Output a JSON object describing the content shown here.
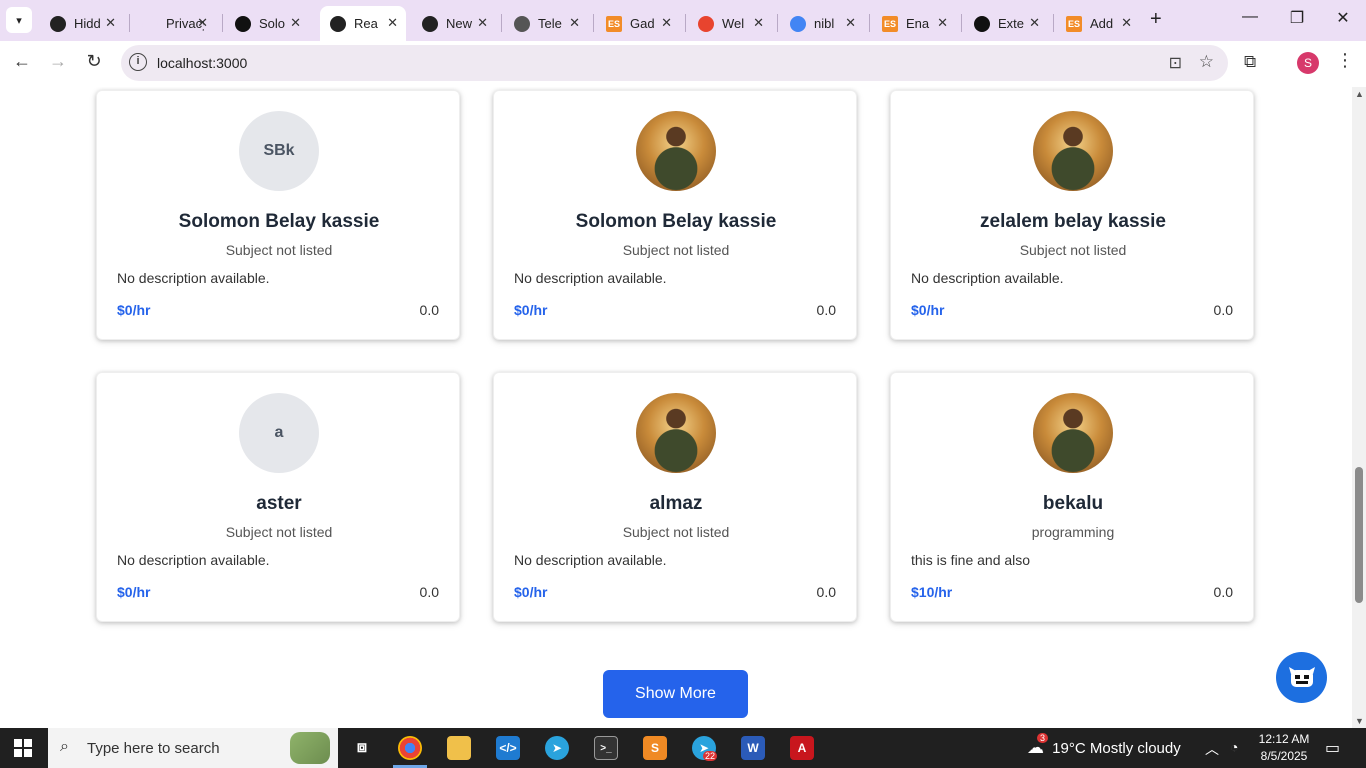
{
  "browser": {
    "tabs": [
      {
        "title": "Hidd",
        "icon": "openai-icon",
        "color": "#222222"
      },
      {
        "title": "Privacy e",
        "icon": "blank-icon",
        "color": "#ecdff5"
      },
      {
        "title": "Solo",
        "icon": "upwork-icon",
        "color": "#111111"
      },
      {
        "title": "Rea",
        "icon": "react-icon",
        "color": "#222222"
      },
      {
        "title": "New",
        "icon": "openai-icon",
        "color": "#222222"
      },
      {
        "title": "Tele",
        "icon": "globe-icon",
        "color": "#555555"
      },
      {
        "title": "Gad",
        "icon": "es-icon",
        "color": "#f28c28"
      },
      {
        "title": "Wel",
        "icon": "link-icon",
        "color": "#e8442e"
      },
      {
        "title": "nibl",
        "icon": "google-icon",
        "color": "#4285f4"
      },
      {
        "title": "Ena",
        "icon": "es-icon",
        "color": "#f28c28"
      },
      {
        "title": "Exte",
        "icon": "angular-icon",
        "color": "#111111"
      },
      {
        "title": "Add",
        "icon": "es-icon",
        "color": "#f28c28"
      }
    ],
    "active_tab": 3,
    "url": "localhost:3000",
    "profile_initial": "S"
  },
  "tutors": [
    {
      "avatar_type": "initials",
      "initials": "SBk",
      "name": "Solomon Belay kassie",
      "subject": "Subject not listed",
      "description": "No description available.",
      "rate": "$0/hr",
      "rating": "0.0"
    },
    {
      "avatar_type": "photo",
      "initials": "",
      "name": "Solomon Belay kassie",
      "subject": "Subject not listed",
      "description": "No description available.",
      "rate": "$0/hr",
      "rating": "0.0"
    },
    {
      "avatar_type": "photo",
      "initials": "",
      "name": "zelalem belay kassie",
      "subject": "Subject not listed",
      "description": "No description available.",
      "rate": "$0/hr",
      "rating": "0.0"
    },
    {
      "avatar_type": "initials",
      "initials": "a",
      "name": "aster",
      "subject": "Subject not listed",
      "description": "No description available.",
      "rate": "$0/hr",
      "rating": "0.0"
    },
    {
      "avatar_type": "photo",
      "initials": "",
      "name": "almaz",
      "subject": "Subject not listed",
      "description": "No description available.",
      "rate": "$0/hr",
      "rating": "0.0"
    },
    {
      "avatar_type": "photo",
      "initials": "",
      "name": "bekalu",
      "subject": "programming",
      "description": "this is fine and also",
      "rate": "$10/hr",
      "rating": "0.0"
    }
  ],
  "show_more_label": "Show More",
  "taskbar": {
    "search_placeholder": "Type here to search",
    "weather_badge": "3",
    "weather": "19°C  Mostly cloudy",
    "time": "12:12 AM",
    "date": "8/5/2025",
    "telegram_badge": "22"
  }
}
